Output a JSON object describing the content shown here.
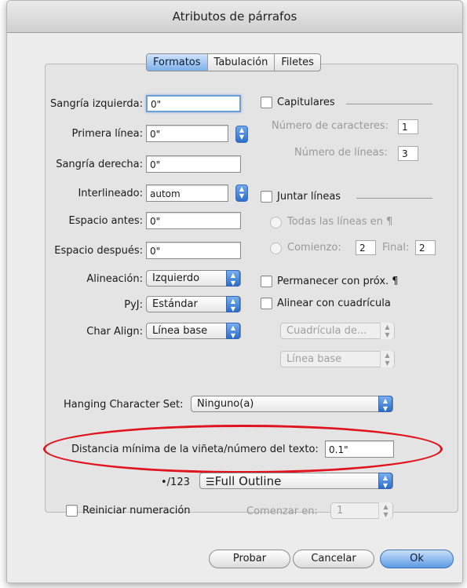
{
  "window": {
    "title": "Atributos de párrafos"
  },
  "tabs": [
    "Formatos",
    "Tabulación",
    "Filetes"
  ],
  "left": {
    "sangria_izquierda": {
      "label": "Sangría izquierda:",
      "value": "0\""
    },
    "primera_linea": {
      "label": "Primera línea:",
      "value": "0\""
    },
    "sangria_derecha": {
      "label": "Sangría derecha:",
      "value": "0\""
    },
    "interlineado": {
      "label": "Interlineado:",
      "value": "autom"
    },
    "espacio_antes": {
      "label": "Espacio antes:",
      "value": "0\""
    },
    "espacio_despues": {
      "label": "Espacio después:",
      "value": "0\""
    },
    "alineacion": {
      "label": "Alineación:",
      "value": "Izquierdo"
    },
    "pyj": {
      "label": "PyJ:",
      "value": "Estándar"
    },
    "char_align": {
      "label": "Char Align:",
      "value": "Línea base"
    }
  },
  "right": {
    "capitulares": {
      "label": "Capitulares"
    },
    "num_caracteres": {
      "label": "Número de caracteres:",
      "value": "1"
    },
    "num_lineas": {
      "label": "Número de líneas:",
      "value": "3"
    },
    "juntar_lineas": {
      "label": "Juntar líneas"
    },
    "todas_lineas": {
      "label": "Todas las líneas en ¶"
    },
    "comienzo": {
      "label": "Comienzo:",
      "value": "2"
    },
    "final": {
      "label": "Final:",
      "value": "2"
    },
    "permanecer": {
      "label": "Permanecer con próx. ¶"
    },
    "alinear_cuadricula": {
      "label": "Alinear con cuadrícula"
    },
    "cuadricula_popup": "Cuadrícula de...",
    "linea_base_popup": "Línea base"
  },
  "hanging": {
    "label": "Hanging Character Set:",
    "value": "Ninguno(a)"
  },
  "distancia": {
    "label": "Distancia mínima de la viñeta/número del texto:",
    "value": "0.1\""
  },
  "bullets": {
    "label": "•/123",
    "icon": "list-icon",
    "value": "Full Outline"
  },
  "reiniciar": {
    "label": "Reiniciar numeración"
  },
  "comenzar": {
    "label": "Comenzar en:",
    "value": "1"
  },
  "buttons": {
    "probar": "Probar",
    "cancelar": "Cancelar",
    "ok": "Ok"
  },
  "colors": {
    "accent": "#5c9ae4",
    "highlight": "#e0141e"
  }
}
